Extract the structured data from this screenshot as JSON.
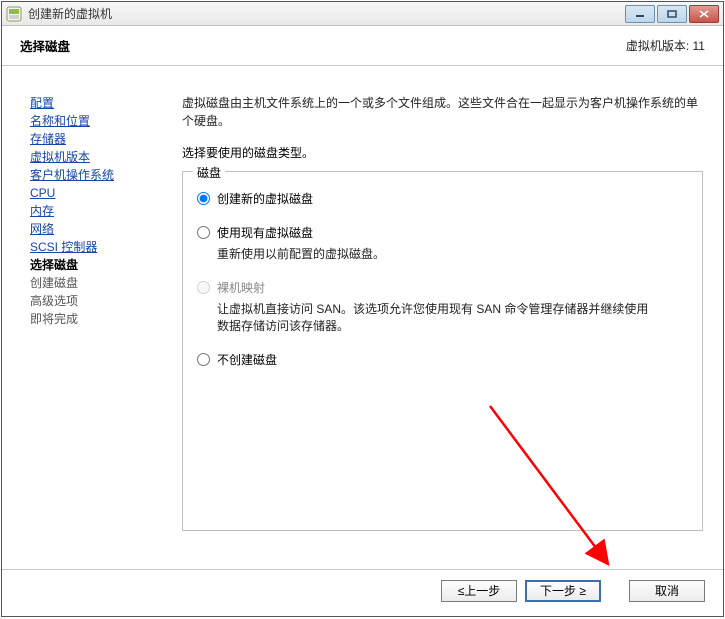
{
  "window": {
    "title": "创建新的虚拟机"
  },
  "header": {
    "subtitle": "选择磁盘",
    "version_label": "虚拟机版本: 11"
  },
  "sidebar": {
    "items": [
      {
        "label": "配置",
        "state": "link"
      },
      {
        "label": "名称和位置",
        "state": "link"
      },
      {
        "label": "存储器",
        "state": "link"
      },
      {
        "label": "虚拟机版本",
        "state": "link"
      },
      {
        "label": "客户机操作系统",
        "state": "link"
      },
      {
        "label": "CPU",
        "state": "link"
      },
      {
        "label": "内存",
        "state": "link"
      },
      {
        "label": "网络",
        "state": "link"
      },
      {
        "label": "SCSI 控制器",
        "state": "link"
      },
      {
        "label": "选择磁盘",
        "state": "current"
      },
      {
        "label": "创建磁盘",
        "state": "pending"
      },
      {
        "label": "高级选项",
        "state": "pending"
      },
      {
        "label": "即将完成",
        "state": "pending"
      }
    ]
  },
  "main": {
    "description": "虚拟磁盘由主机文件系统上的一个或多个文件组成。这些文件合在一起显示为客户机操作系统的单个硬盘。",
    "prompt": "选择要使用的磁盘类型。",
    "group_title": "磁盘",
    "options": [
      {
        "label": "创建新的虚拟磁盘",
        "sub": "",
        "disabled": false,
        "checked": true
      },
      {
        "label": "使用现有虚拟磁盘",
        "sub": "重新使用以前配置的虚拟磁盘。",
        "disabled": false,
        "checked": false
      },
      {
        "label": "裸机映射",
        "sub": "让虚拟机直接访问 SAN。该选项允许您使用现有 SAN 命令管理存储器并继续使用数据存储访问该存储器。",
        "disabled": true,
        "checked": false
      },
      {
        "label": "不创建磁盘",
        "sub": "",
        "disabled": false,
        "checked": false
      }
    ]
  },
  "footer": {
    "back": "≤上一步",
    "next": "下一步 ≥",
    "cancel": "取消"
  }
}
